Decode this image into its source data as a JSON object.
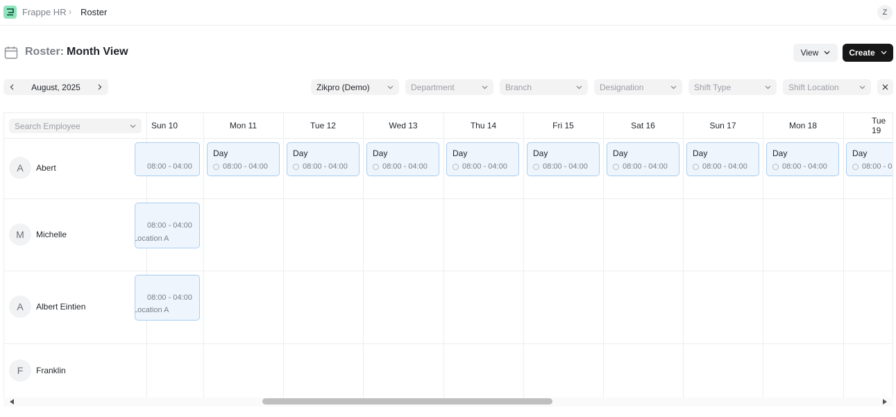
{
  "nav": {
    "app": "Frappe HR",
    "separator": "›",
    "current": "Roster",
    "user_initial": "Z"
  },
  "header": {
    "title_prefix": "Roster:",
    "title": "Month View",
    "view_label": "View",
    "create_label": "Create"
  },
  "month_nav": {
    "label": "August, 2025"
  },
  "filters": {
    "company": "Zikpro (Demo)",
    "department": "Department",
    "branch": "Branch",
    "designation": "Designation",
    "shift_type": "Shift Type",
    "shift_location": "Shift Location"
  },
  "grid": {
    "search_placeholder": "Search Employee",
    "days": [
      "Sun 10",
      "Mon 11",
      "Tue 12",
      "Wed 13",
      "Thu 14",
      "Fri 15",
      "Sat 16",
      "Sun 17",
      "Mon 18",
      "Tue 19"
    ],
    "employees": [
      {
        "initial": "A",
        "name": "Abert"
      },
      {
        "initial": "M",
        "name": "Michelle"
      },
      {
        "initial": "A",
        "name": "Albert Eintien"
      },
      {
        "initial": "F",
        "name": "Franklin"
      }
    ],
    "shift": {
      "name": "Day",
      "time": "08:00 - 04:00",
      "location": "Location A"
    }
  },
  "colors": {
    "shift_bg": "#eef5fd",
    "shift_border": "#a9cdf0",
    "create_bg": "#171717",
    "logo_bg": "#8fe3bd"
  }
}
